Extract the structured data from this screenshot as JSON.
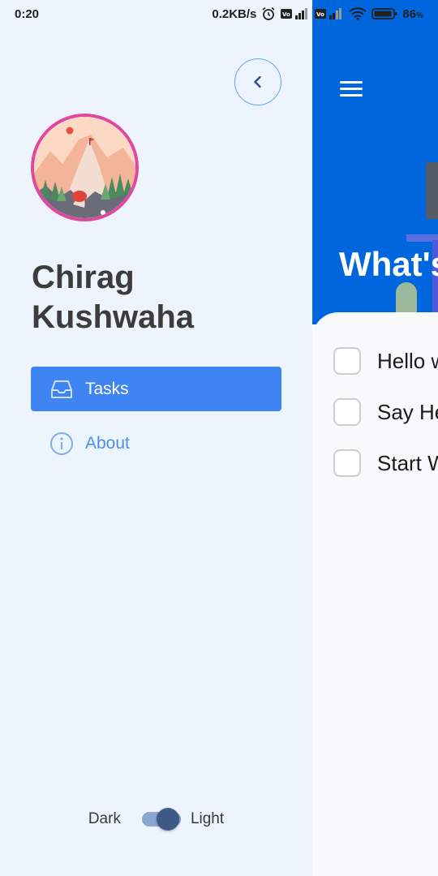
{
  "status_bar": {
    "time": "0:20",
    "speed": "0.2KB/s",
    "battery": "86"
  },
  "drawer": {
    "user_name": "Chirag Kushwaha",
    "nav": [
      {
        "label": "Tasks",
        "icon": "inbox-icon",
        "active": true
      },
      {
        "label": "About",
        "icon": "info-icon",
        "active": false
      }
    ],
    "theme": {
      "dark_label": "Dark",
      "light_label": "Light",
      "mode": "light"
    }
  },
  "main": {
    "title": "What's",
    "tasks": [
      {
        "title": "Hello w",
        "done": false
      },
      {
        "title": "Say He",
        "done": false
      },
      {
        "title": "Start W",
        "done": false
      }
    ]
  },
  "colors": {
    "drawer_bg": "#eef4fe",
    "accent": "#3e84f2",
    "header_blue": "#0066dd",
    "avatar_ring": "#e0479e",
    "toggle_knob": "#3d5a87"
  }
}
